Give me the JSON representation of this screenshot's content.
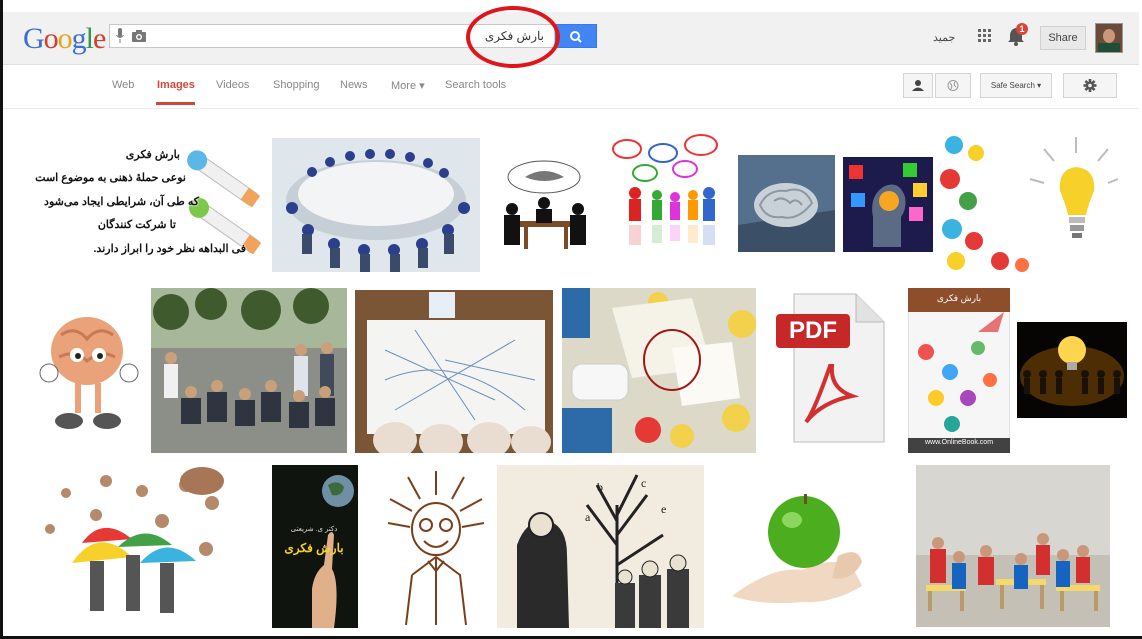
{
  "logo": {
    "G1": "G",
    "o1": "o",
    "o2": "o",
    "g": "g",
    "l": "l",
    "e": "e"
  },
  "search": {
    "query": "بارش فکری"
  },
  "account": {
    "name": "جمید",
    "notifications": "1",
    "share_label": "Share"
  },
  "nav": {
    "tabs": [
      {
        "label": "Web"
      },
      {
        "label": "Images"
      },
      {
        "label": "Videos"
      },
      {
        "label": "Shopping"
      },
      {
        "label": "News"
      },
      {
        "label": "More ▾"
      },
      {
        "label": "Search tools"
      }
    ],
    "safe_search_label": "Safe Search ▾"
  },
  "images": {
    "brainstorm_caption": [
      "بارش فکری",
      "نوعی حملهٔ ذهنی به موضوع است",
      "که طی آن، شرایطی ایجاد می‌شود",
      "تا شرکت کنندگان",
      "فی البداهه نظر خود را ابراز دارند."
    ],
    "pdf_label": "PDF",
    "book_cover_title": "بارش فکری",
    "book_cover_author": "دکتر ی. شریعتی",
    "book2_title": "بارش فکری",
    "book2_url": "www.OnlineBook.com"
  },
  "colors": {
    "accent": "#d14836",
    "search_button": "#4285f4",
    "annotation": "#e0151b"
  }
}
